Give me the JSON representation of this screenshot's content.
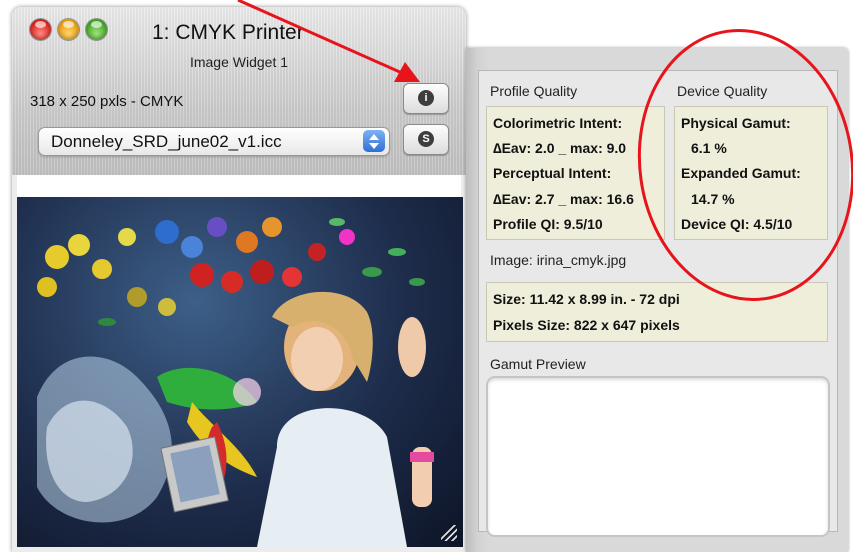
{
  "window": {
    "title": "1: CMYK Printer",
    "subtitle": "Image Widget 1",
    "image_info": "318 x 250 pxls - CMYK",
    "profile_select": "Donneley_SRD_june02_v1.icc",
    "info_button_glyph": "i",
    "s_button_glyph": "S"
  },
  "profile_quality": {
    "header": "Profile Quality",
    "lines": [
      "Colorimetric Intent:",
      "∆Eav: 2.0 _ max: 9.0",
      "Perceptual Intent:",
      "∆Eav: 2.7 _ max: 16.6",
      "Profile QI: 9.5/10"
    ]
  },
  "device_quality": {
    "header": "Device Quality",
    "lines": [
      "Physical Gamut:",
      "6.1 %",
      "Expanded Gamut:",
      "14.7 %",
      "Device QI: 4.5/10"
    ]
  },
  "image": {
    "header": "Image: irina_cmyk.jpg",
    "size": "Size: 11.42 x 8.99 in.  -  72 dpi",
    "pixels": "Pixels Size: 822 x 647 pixels"
  },
  "gamut_preview": {
    "header": "Gamut Preview"
  },
  "colors": {
    "annotation_red": "#e8141c",
    "panel_box_bg": "#efeedb"
  },
  "icons": [
    "info-icon",
    "s-icon",
    "resize-grip-icon",
    "popup-arrows-icon"
  ]
}
